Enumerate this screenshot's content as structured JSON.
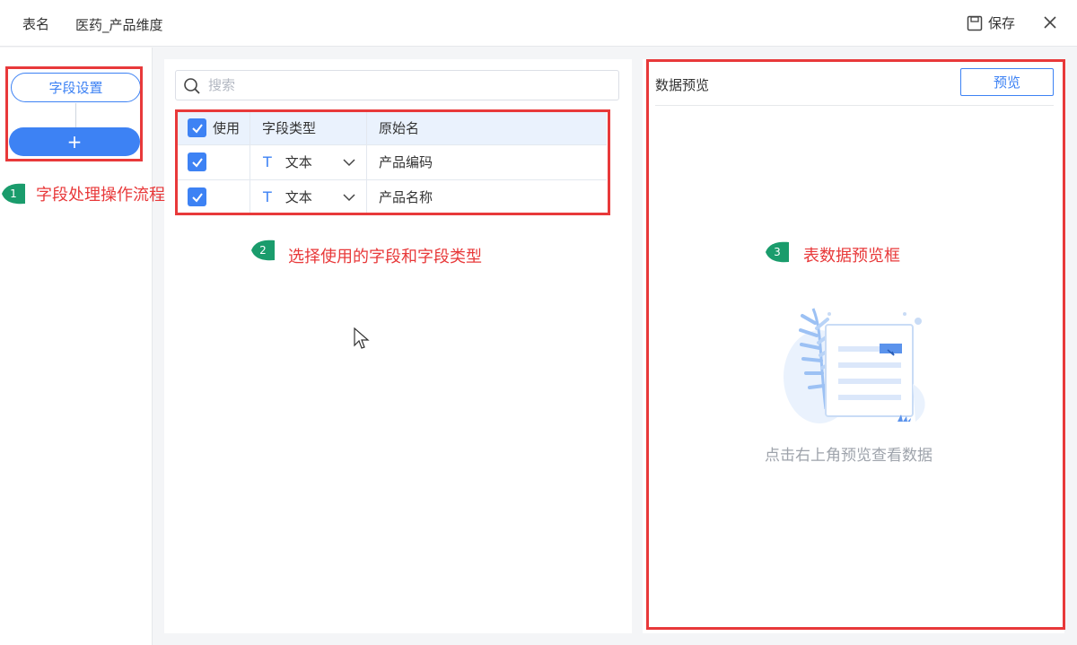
{
  "header": {
    "table_name_label": "表名",
    "table_name_value": "医药_产品维度",
    "save_label": "保存",
    "save_icon": "save-icon",
    "close_icon": "close-icon"
  },
  "left": {
    "step_label": "字段设置",
    "add_label": "+"
  },
  "middle": {
    "search_placeholder": "搜索",
    "columns": [
      "使用",
      "字段类型",
      "原始名"
    ],
    "rows": [
      {
        "checked": true,
        "type_icon": "T",
        "type": "文本",
        "name": "产品编码"
      },
      {
        "checked": true,
        "type_icon": "T",
        "type": "文本",
        "name": "产品名称"
      }
    ]
  },
  "right": {
    "title": "数据预览",
    "preview_button": "预览",
    "empty_hint": "点击右上角预览查看数据"
  },
  "annotations": [
    {
      "number": "1",
      "text": "字段处理操作流程"
    },
    {
      "number": "2",
      "text": "选择使用的字段和字段类型"
    },
    {
      "number": "3",
      "text": "表数据预览框"
    }
  ],
  "colors": {
    "accent": "#3d82f4",
    "annotation_red": "#e8393a",
    "bubble_green": "#1a9c6c"
  }
}
